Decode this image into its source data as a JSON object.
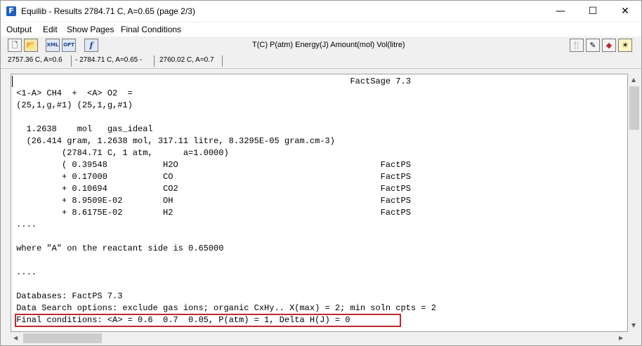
{
  "window": {
    "title": "Equilib - Results  2784.71 C, A=0.65  (page 2/3)",
    "minimize_glyph": "—",
    "maximize_glyph": "☐",
    "close_glyph": "✕"
  },
  "menu": {
    "items": [
      "Output",
      "Edit",
      "Show Pages",
      "Final Conditions"
    ]
  },
  "toolbar": {
    "units": "T(C)  P(atm)  Energy(J)  Amount(mol)  Vol(litre)",
    "icons": [
      "new-file-icon",
      "open-folder-icon",
      "xml-icon",
      "opt-icon",
      "function-icon",
      "utensils-icon",
      "edit-list-icon",
      "bookmark-icon",
      "bulb-icon"
    ]
  },
  "tabs": [
    "2757.36 C, A=0.6",
    "- 2784.71 C, A=0.65 -",
    "2760.02 C, A=0.7"
  ],
  "results_lines": [
    "                                                                   FactSage 7.3",
    " <1-A> CH4  +  <A> O2  =",
    " (25,1,g,#1) (25,1,g,#1)",
    "",
    "   1.2638    mol   gas_ideal",
    "   (26.414 gram, 1.2638 mol, 317.11 litre, 8.3295E-05 gram.cm-3)",
    "          (2784.71 C, 1 atm,      a=1.0000)",
    "          ( 0.39548           H2O                                        FactPS",
    "          + 0.17000           CO                                         FactPS",
    "          + 0.10694           CO2                                        FactPS",
    "          + 8.9509E-02        OH                                         FactPS",
    "          + 8.6175E-02        H2                                         FactPS",
    " ....",
    "",
    " where \"A\" on the reactant side is 0.65000",
    "",
    " ....",
    "",
    " Databases: FactPS 7.3",
    " Data Search options: exclude gas ions; organic CxHy.. X(max) = 2; min soln cpts = 2",
    " Final conditions: <A> = 0.6  0.7  0.05, P(atm) = 1, Delta H(J) = 0"
  ],
  "colors": {
    "highlight": "#c0272d",
    "button_blue": "#1d3f8f"
  }
}
